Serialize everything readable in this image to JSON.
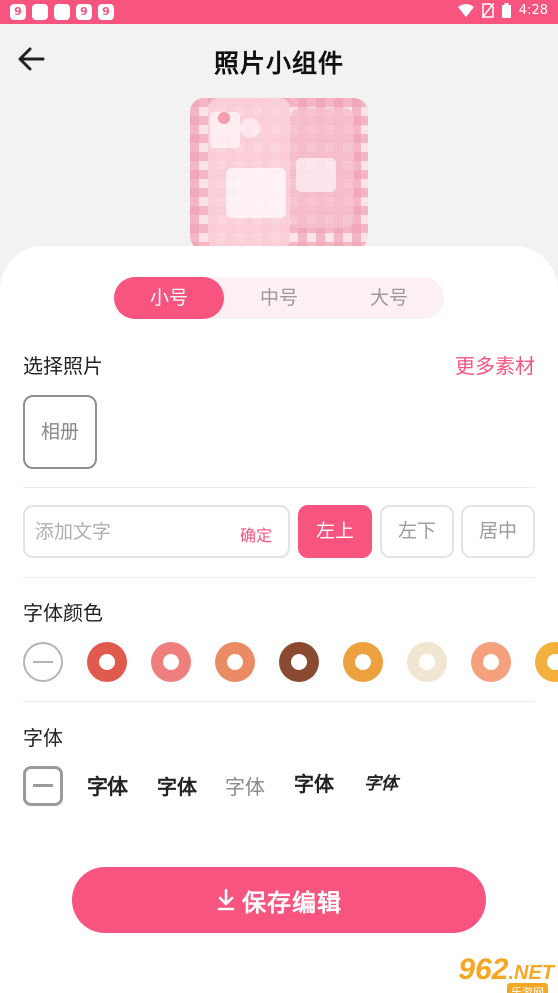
{
  "status_bar": {
    "app_icons": [
      "9",
      "",
      "",
      "9",
      "9"
    ],
    "time": "4:28"
  },
  "header": {
    "title": "照片小组件"
  },
  "size_tabs": [
    {
      "label": "小号",
      "active": true
    },
    {
      "label": "中号",
      "active": false
    },
    {
      "label": "大号",
      "active": false
    }
  ],
  "photo_section": {
    "title": "选择照片",
    "more_link": "更多素材",
    "album_button": "相册"
  },
  "text_section": {
    "placeholder": "添加文字",
    "value": "",
    "confirm": "确定",
    "positions": [
      {
        "label": "左上",
        "active": true
      },
      {
        "label": "左下",
        "active": false
      },
      {
        "label": "居中",
        "active": false
      }
    ]
  },
  "color_section": {
    "title": "字体颜色",
    "swatches": [
      "#e05a4e",
      "#ee7f7d",
      "#ea8b63",
      "#8a4a32",
      "#eda03e",
      "#f0e6d2",
      "#f5a17e",
      "#f3b03c"
    ]
  },
  "font_section": {
    "title": "字体",
    "options": [
      "字体",
      "字体",
      "字体",
      "字体",
      "字体"
    ]
  },
  "save_button": {
    "label": "保存编辑"
  },
  "watermark": {
    "main": "962",
    "suffix": ".NET",
    "sub": "乐游网"
  },
  "colors": {
    "accent": "#f7547f",
    "tab_bg": "#fdf0f2"
  }
}
